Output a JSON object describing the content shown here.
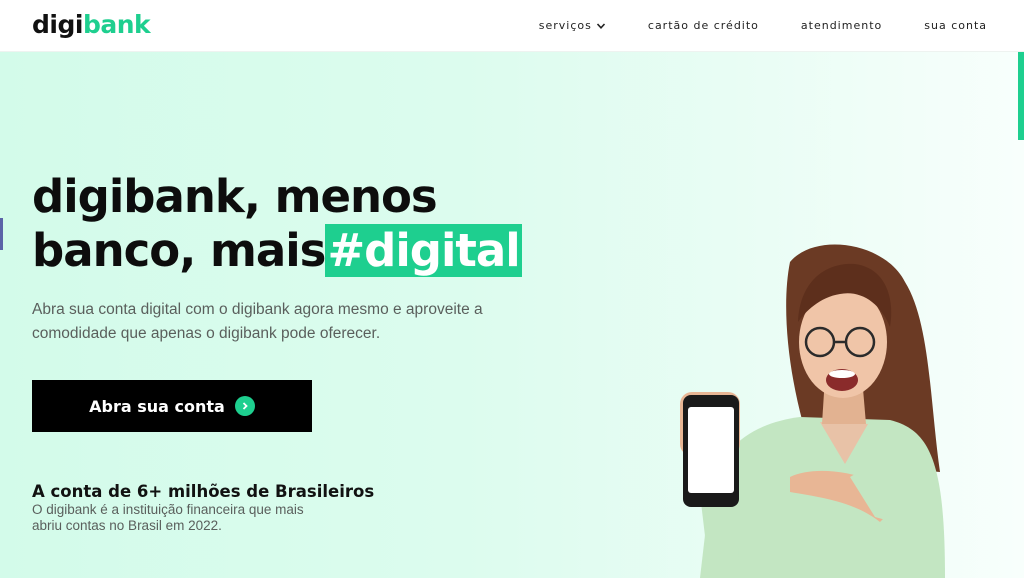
{
  "header": {
    "logo": {
      "part1": "digi",
      "part2": "bank"
    },
    "nav": [
      {
        "label": "serviços",
        "has_dropdown": true
      },
      {
        "label": "cartão de crédito"
      },
      {
        "label": "atendimento"
      },
      {
        "label": "sua conta"
      }
    ]
  },
  "hero": {
    "headline_line1": "digibank, menos",
    "headline_line2_prefix": "banco, mais",
    "headline_highlight": "#digital",
    "subtitle": "Abra sua conta digital com o digibank agora mesmo e aproveite a comodidade que apenas o digibank pode oferecer.",
    "cta_label": "Abra sua conta",
    "stat_title": "A conta de 6+ milhões de Brasileiros",
    "stat_desc": "O digibank é a instituição financeira que mais abriu contas no Brasil em 2022."
  },
  "colors": {
    "accent": "#1ecf8f",
    "hero_bg": "#d3fbea",
    "text_dark": "#0d0d0d",
    "text_muted": "#5a5f5c",
    "cta_bg": "#000000"
  },
  "icons": [
    "chevron-down-icon",
    "chevron-right-icon"
  ]
}
